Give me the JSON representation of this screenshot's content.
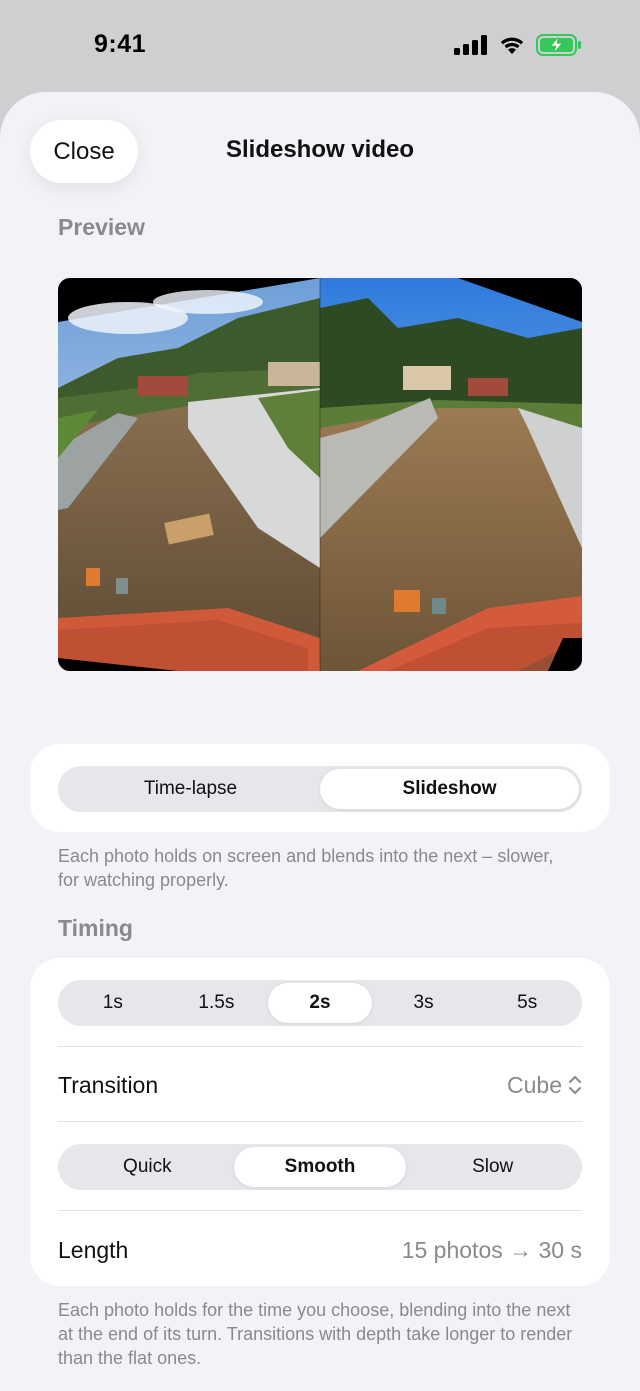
{
  "status_bar": {
    "time": "9:41"
  },
  "header": {
    "close_label": "Close",
    "title": "Slideshow video"
  },
  "preview": {
    "section_label": "Preview"
  },
  "mode_selector": {
    "options": [
      "Time-lapse",
      "Slideshow"
    ],
    "selected": "Slideshow",
    "description": "Each photo holds on screen and blends into the next – slower, for watching properly."
  },
  "timing": {
    "section_label": "Timing",
    "durations": [
      "1s",
      "1.5s",
      "2s",
      "3s",
      "5s"
    ],
    "selected_duration": "2s",
    "transition_label": "Transition",
    "transition_value": "Cube",
    "speeds": [
      "Quick",
      "Smooth",
      "Slow"
    ],
    "selected_speed": "Smooth",
    "length_label": "Length",
    "length_value": "15 photos → 30 s",
    "footnote": "Each photo holds for the time you choose, blending into the next at the end of its turn. Transitions with depth take longer to render than the flat ones."
  },
  "colors": {
    "sheet_background": "#f2f2f7",
    "card_background": "#ffffff",
    "segment_track": "#e6e6eb",
    "secondary_text": "#8a8a8e",
    "battery_green": "#34c759"
  }
}
